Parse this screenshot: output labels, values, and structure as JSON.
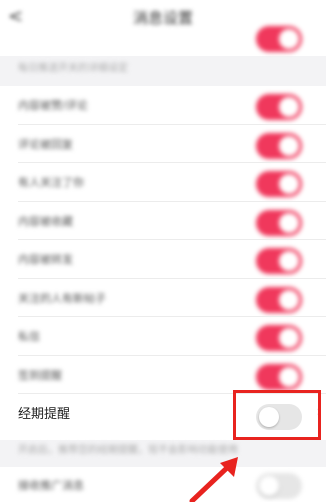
{
  "header": {
    "back_icon": "chevron-left-icon",
    "title": "消息设置"
  },
  "section": {
    "label": "每日推送开关的详细设定"
  },
  "rows": [
    {
      "label": "内容被赞/评论",
      "on": true
    },
    {
      "label": "评论被回复",
      "on": true
    },
    {
      "label": "有人关注了你",
      "on": true
    },
    {
      "label": "内容被收藏",
      "on": true
    },
    {
      "label": "内容被转发",
      "on": true
    },
    {
      "label": "关注的人有新帖子",
      "on": true
    },
    {
      "label": "私信",
      "on": true
    },
    {
      "label": "签到提醒",
      "on": true
    }
  ],
  "period": {
    "label": "经期提醒",
    "on": false,
    "chevron_icon": "chevron-right-icon"
  },
  "hint": "开启后，推荐您的经期提醒，现不会影响功能使用",
  "bottom": {
    "label": "接收推广消息",
    "on": false
  },
  "colors": {
    "accent": "#f0385c",
    "highlight": "#e8231f"
  }
}
